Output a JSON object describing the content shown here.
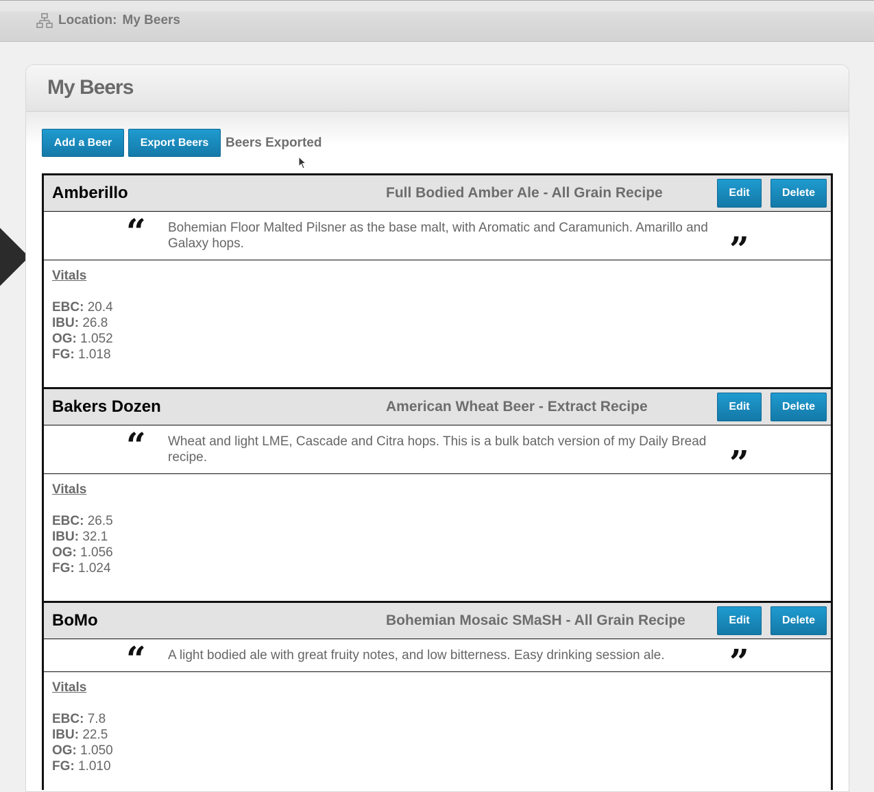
{
  "location": {
    "prefix": "Location:",
    "value": "My Beers"
  },
  "page": {
    "title": "My Beers"
  },
  "toolbar": {
    "add_label": "Add a Beer",
    "export_label": "Export Beers",
    "status": "Beers Exported"
  },
  "labels": {
    "edit": "Edit",
    "delete": "Delete",
    "vitals": "Vitals",
    "open_quote": "“",
    "close_quote": "”"
  },
  "beers": [
    {
      "name": "Amberillo",
      "style": "Full Bodied Amber Ale - All Grain Recipe",
      "description": "Bohemian Floor Malted Pilsner as the base malt, with Aromatic and Caramunich. Amarillo and Galaxy hops.",
      "vitals": [
        {
          "key": "EBC:",
          "value": "20.4"
        },
        {
          "key": "IBU:",
          "value": "26.8"
        },
        {
          "key": "OG:",
          "value": "1.052"
        },
        {
          "key": "FG:",
          "value": "1.018"
        }
      ]
    },
    {
      "name": "Bakers Dozen",
      "style": "American Wheat Beer - Extract Recipe",
      "description": "Wheat and light LME, Cascade and Citra hops. This is a bulk batch version of my Daily Bread recipe.",
      "vitals": [
        {
          "key": "EBC:",
          "value": "26.5"
        },
        {
          "key": "IBU:",
          "value": "32.1"
        },
        {
          "key": "OG:",
          "value": "1.056"
        },
        {
          "key": "FG:",
          "value": "1.024"
        }
      ]
    },
    {
      "name": "BoMo",
      "style": "Bohemian Mosaic SMaSH - All Grain Recipe",
      "description": "A light bodied ale with great fruity notes, and low bitterness. Easy drinking session ale.",
      "vitals": [
        {
          "key": "EBC:",
          "value": "7.8"
        },
        {
          "key": "IBU:",
          "value": "22.5"
        },
        {
          "key": "OG:",
          "value": "1.050"
        },
        {
          "key": "FG:",
          "value": "1.010"
        }
      ]
    }
  ]
}
